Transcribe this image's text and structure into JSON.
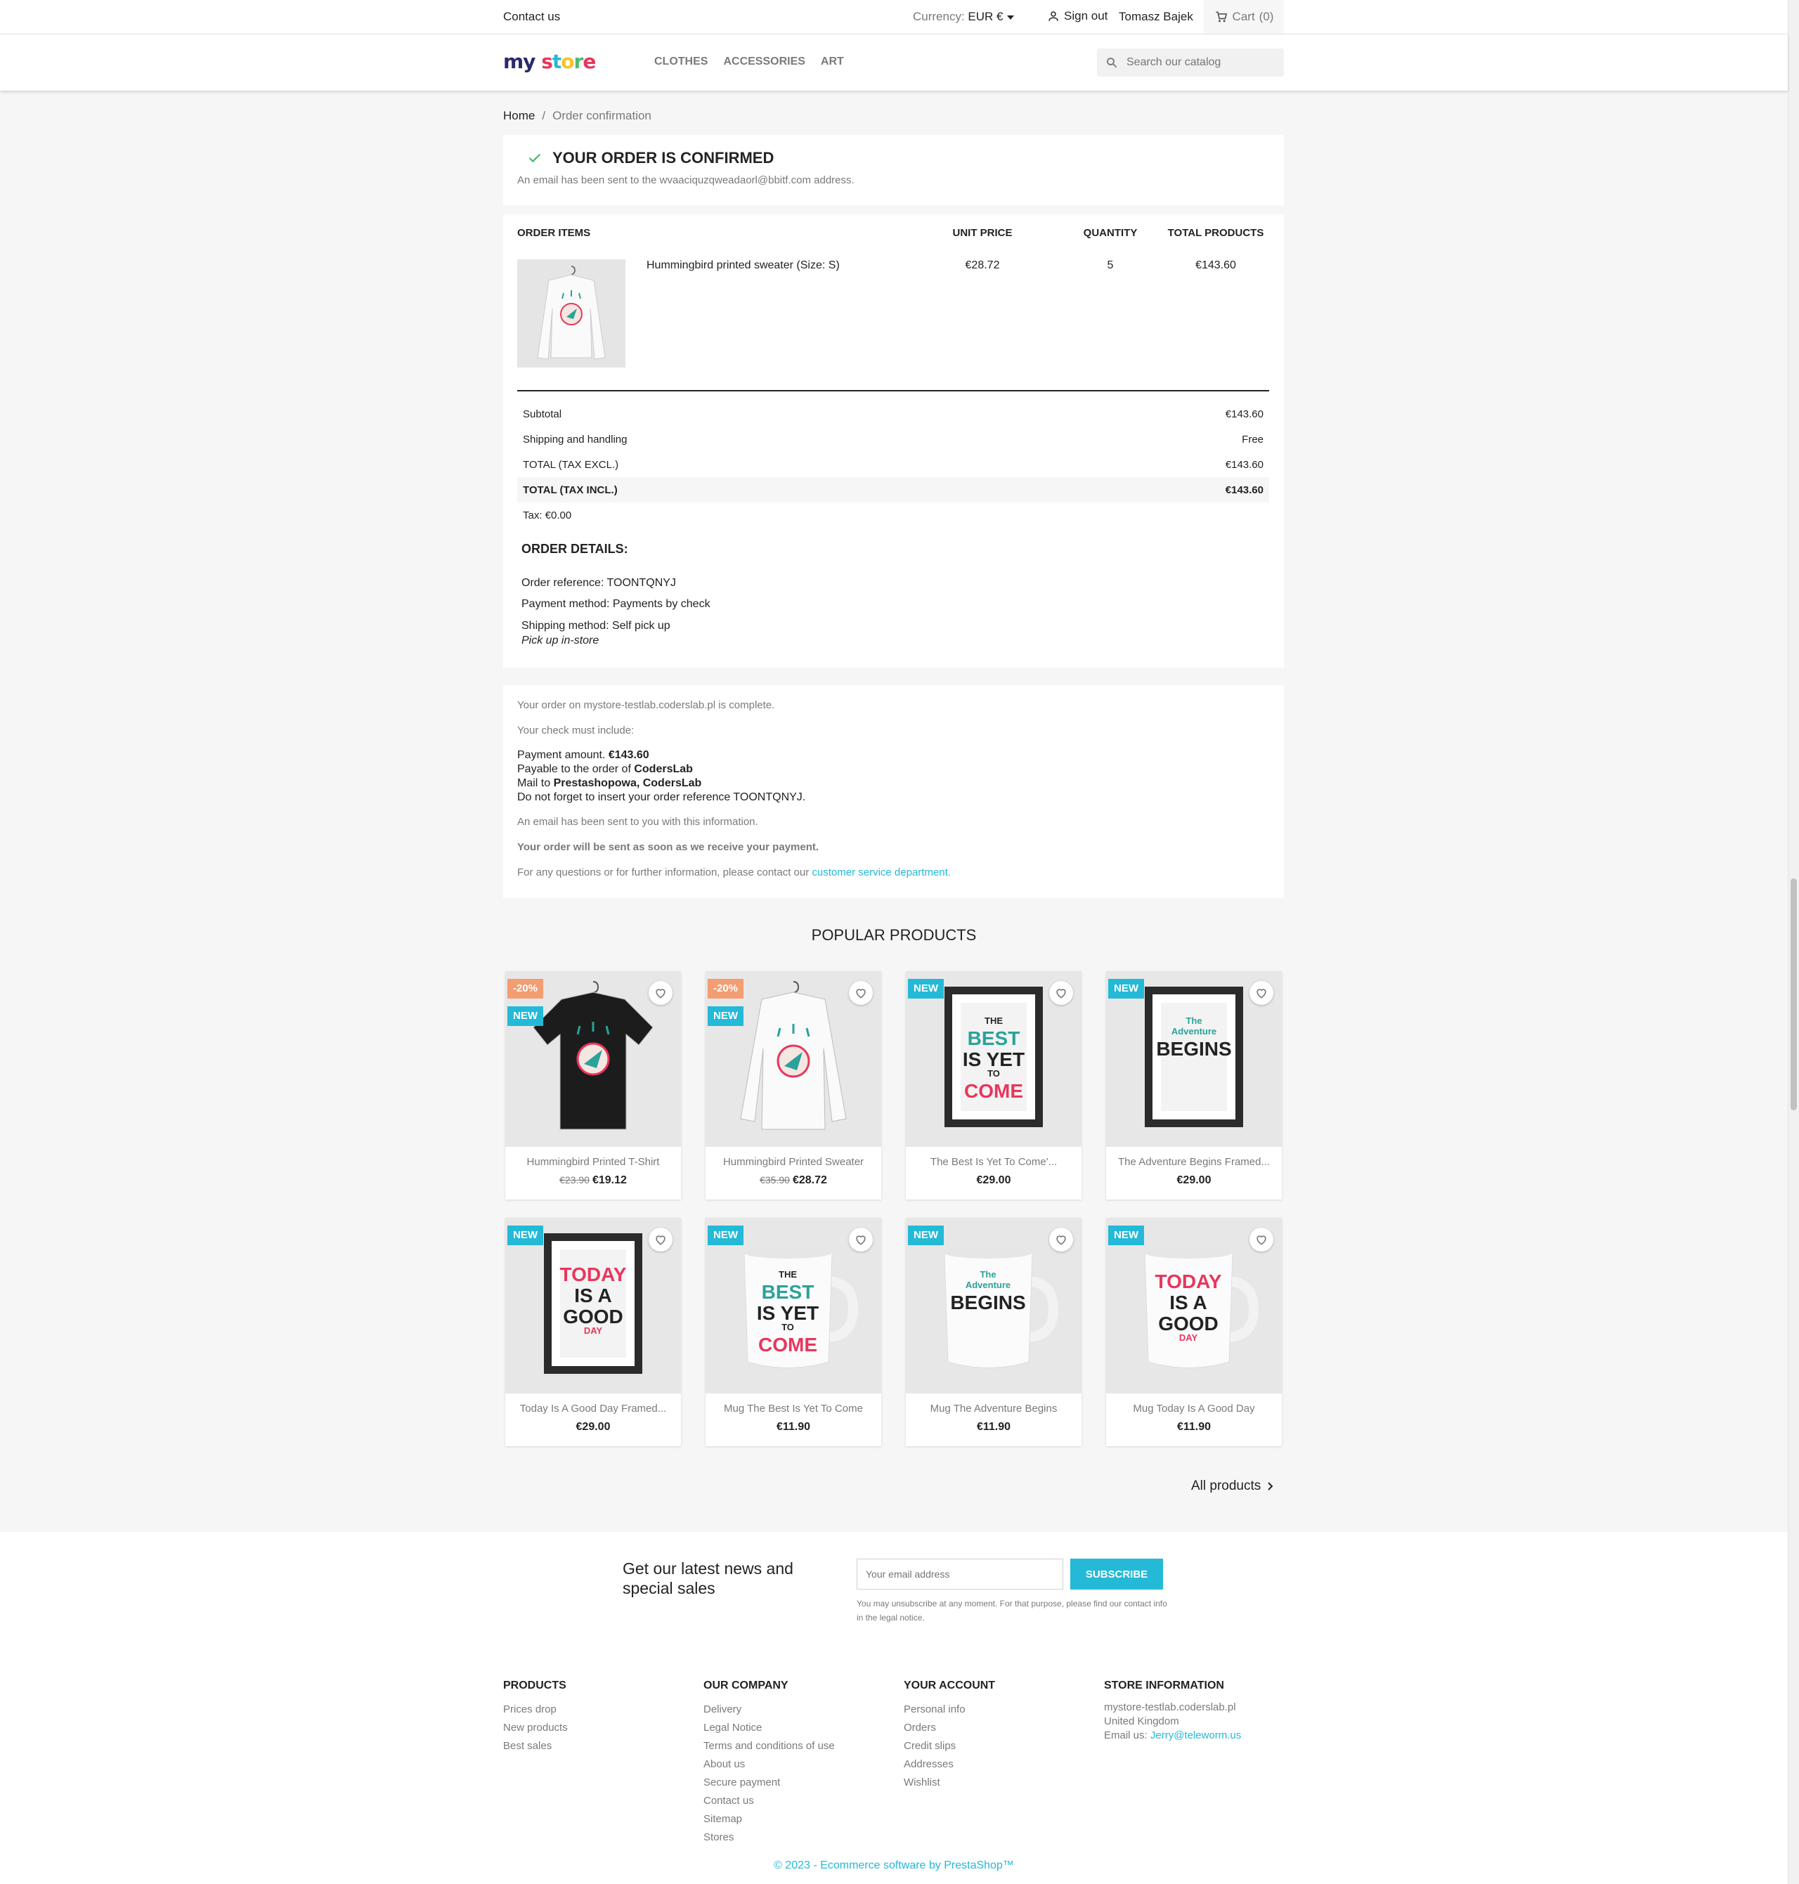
{
  "topbar": {
    "contact": "Contact us",
    "currency_label": "Currency:",
    "currency_value": "EUR €",
    "signout": "Sign out",
    "username": "Tomasz Bajek",
    "cart": "Cart",
    "cart_count": "(0)"
  },
  "header": {
    "logo": "my store",
    "nav": [
      "CLOTHES",
      "ACCESSORIES",
      "ART"
    ],
    "search_placeholder": "Search our catalog"
  },
  "breadcrumb": {
    "home": "Home",
    "current": "Order confirmation"
  },
  "confirmation": {
    "title": "YOUR ORDER IS CONFIRMED",
    "text": "An email has been sent to the wvaaciquzqweadaorl@bbitf.com address."
  },
  "order": {
    "headers": {
      "items": "ORDER ITEMS",
      "unit_price": "UNIT PRICE",
      "quantity": "QUANTITY",
      "total": "TOTAL PRODUCTS"
    },
    "item": {
      "name": "Hummingbird printed sweater (Size: S)",
      "unit_price": "€28.72",
      "quantity": "5",
      "total": "€143.60"
    },
    "totals": [
      {
        "label": "Subtotal",
        "value": "€143.60"
      },
      {
        "label": "Shipping and handling",
        "value": "Free"
      },
      {
        "label": "TOTAL (TAX EXCL.)",
        "value": "€143.60"
      },
      {
        "label": "TOTAL (TAX INCL.)",
        "value": "€143.60"
      },
      {
        "label": "Tax: €0.00",
        "value": ""
      }
    ],
    "details_title": "ORDER DETAILS:",
    "reference": "Order reference: TOONTQNYJ",
    "payment": "Payment method: Payments by check",
    "shipping": "Shipping method: Self pick up",
    "shipping_note": "Pick up in-store"
  },
  "payment_info": {
    "complete": "Your order on mystore-testlab.coderslab.pl is complete.",
    "must_include": "Your check must include:",
    "amount_label": "Payment amount.",
    "amount": "€143.60",
    "payable_label": "Payable to the order of",
    "payable": "CodersLab",
    "mail_label": "Mail to",
    "mail": "Prestashopowa, CodersLab",
    "reminder": "Do not forget to insert your order reference TOONTQNYJ.",
    "email_sent": "An email has been sent to you with this information.",
    "sent_note": "Your order will be sent as soon as we receive your payment.",
    "questions": "For any questions or for further information, please contact our",
    "link": "customer service department."
  },
  "popular": {
    "title": "POPULAR PRODUCTS",
    "products": [
      {
        "name": "Hummingbird Printed T-Shirt",
        "old_price": "€23.90",
        "price": "€19.12",
        "discount": "-20%",
        "new": "NEW"
      },
      {
        "name": "Hummingbird Printed Sweater",
        "old_price": "€35.90",
        "price": "€28.72",
        "discount": "-20%",
        "new": "NEW"
      },
      {
        "name": "The Best Is Yet To Come'...",
        "old_price": "",
        "price": "€29.00",
        "discount": "",
        "new": "NEW"
      },
      {
        "name": "The Adventure Begins Framed...",
        "old_price": "",
        "price": "€29.00",
        "discount": "",
        "new": "NEW"
      },
      {
        "name": "Today Is A Good Day Framed...",
        "old_price": "",
        "price": "€29.00",
        "discount": "",
        "new": "NEW"
      },
      {
        "name": "Mug The Best Is Yet To Come",
        "old_price": "",
        "price": "€11.90",
        "discount": "",
        "new": "NEW"
      },
      {
        "name": "Mug The Adventure Begins",
        "old_price": "",
        "price": "€11.90",
        "discount": "",
        "new": "NEW"
      },
      {
        "name": "Mug Today Is A Good Day",
        "old_price": "",
        "price": "€11.90",
        "discount": "",
        "new": "NEW"
      }
    ],
    "art": {
      "best": [
        "THE",
        "BEST",
        "IS YET",
        "TO",
        "COME"
      ],
      "adventure": [
        "The",
        "Adventure",
        "BEGINS"
      ],
      "today": [
        "TODAY",
        "IS A",
        "GOOD",
        "DAY"
      ]
    },
    "all_products": "All products"
  },
  "newsletter": {
    "title": "Get our latest news and special sales",
    "placeholder": "Your email address",
    "button": "SUBSCRIBE",
    "note": "You may unsubscribe at any moment. For that purpose, please find our contact info in the legal notice."
  },
  "footer": {
    "products": {
      "title": "PRODUCTS",
      "links": [
        "Prices drop",
        "New products",
        "Best sales"
      ]
    },
    "company": {
      "title": "OUR COMPANY",
      "links": [
        "Delivery",
        "Legal Notice",
        "Terms and conditions of use",
        "About us",
        "Secure payment",
        "Contact us",
        "Sitemap",
        "Stores"
      ]
    },
    "account": {
      "title": "YOUR ACCOUNT",
      "links": [
        "Personal info",
        "Orders",
        "Credit slips",
        "Addresses",
        "Wishlist"
      ]
    },
    "store": {
      "title": "STORE INFORMATION",
      "line1": "mystore-testlab.coderslab.pl",
      "line2": "United Kingdom",
      "email_label": "Email us:",
      "email": "Jerry@teleworm.us"
    },
    "copyright": "© 2023 - Ecommerce software by PrestaShop™"
  },
  "colors": {
    "accent": "#24b9d7",
    "discount": "#f39d72",
    "success": "#4cbb6c"
  }
}
